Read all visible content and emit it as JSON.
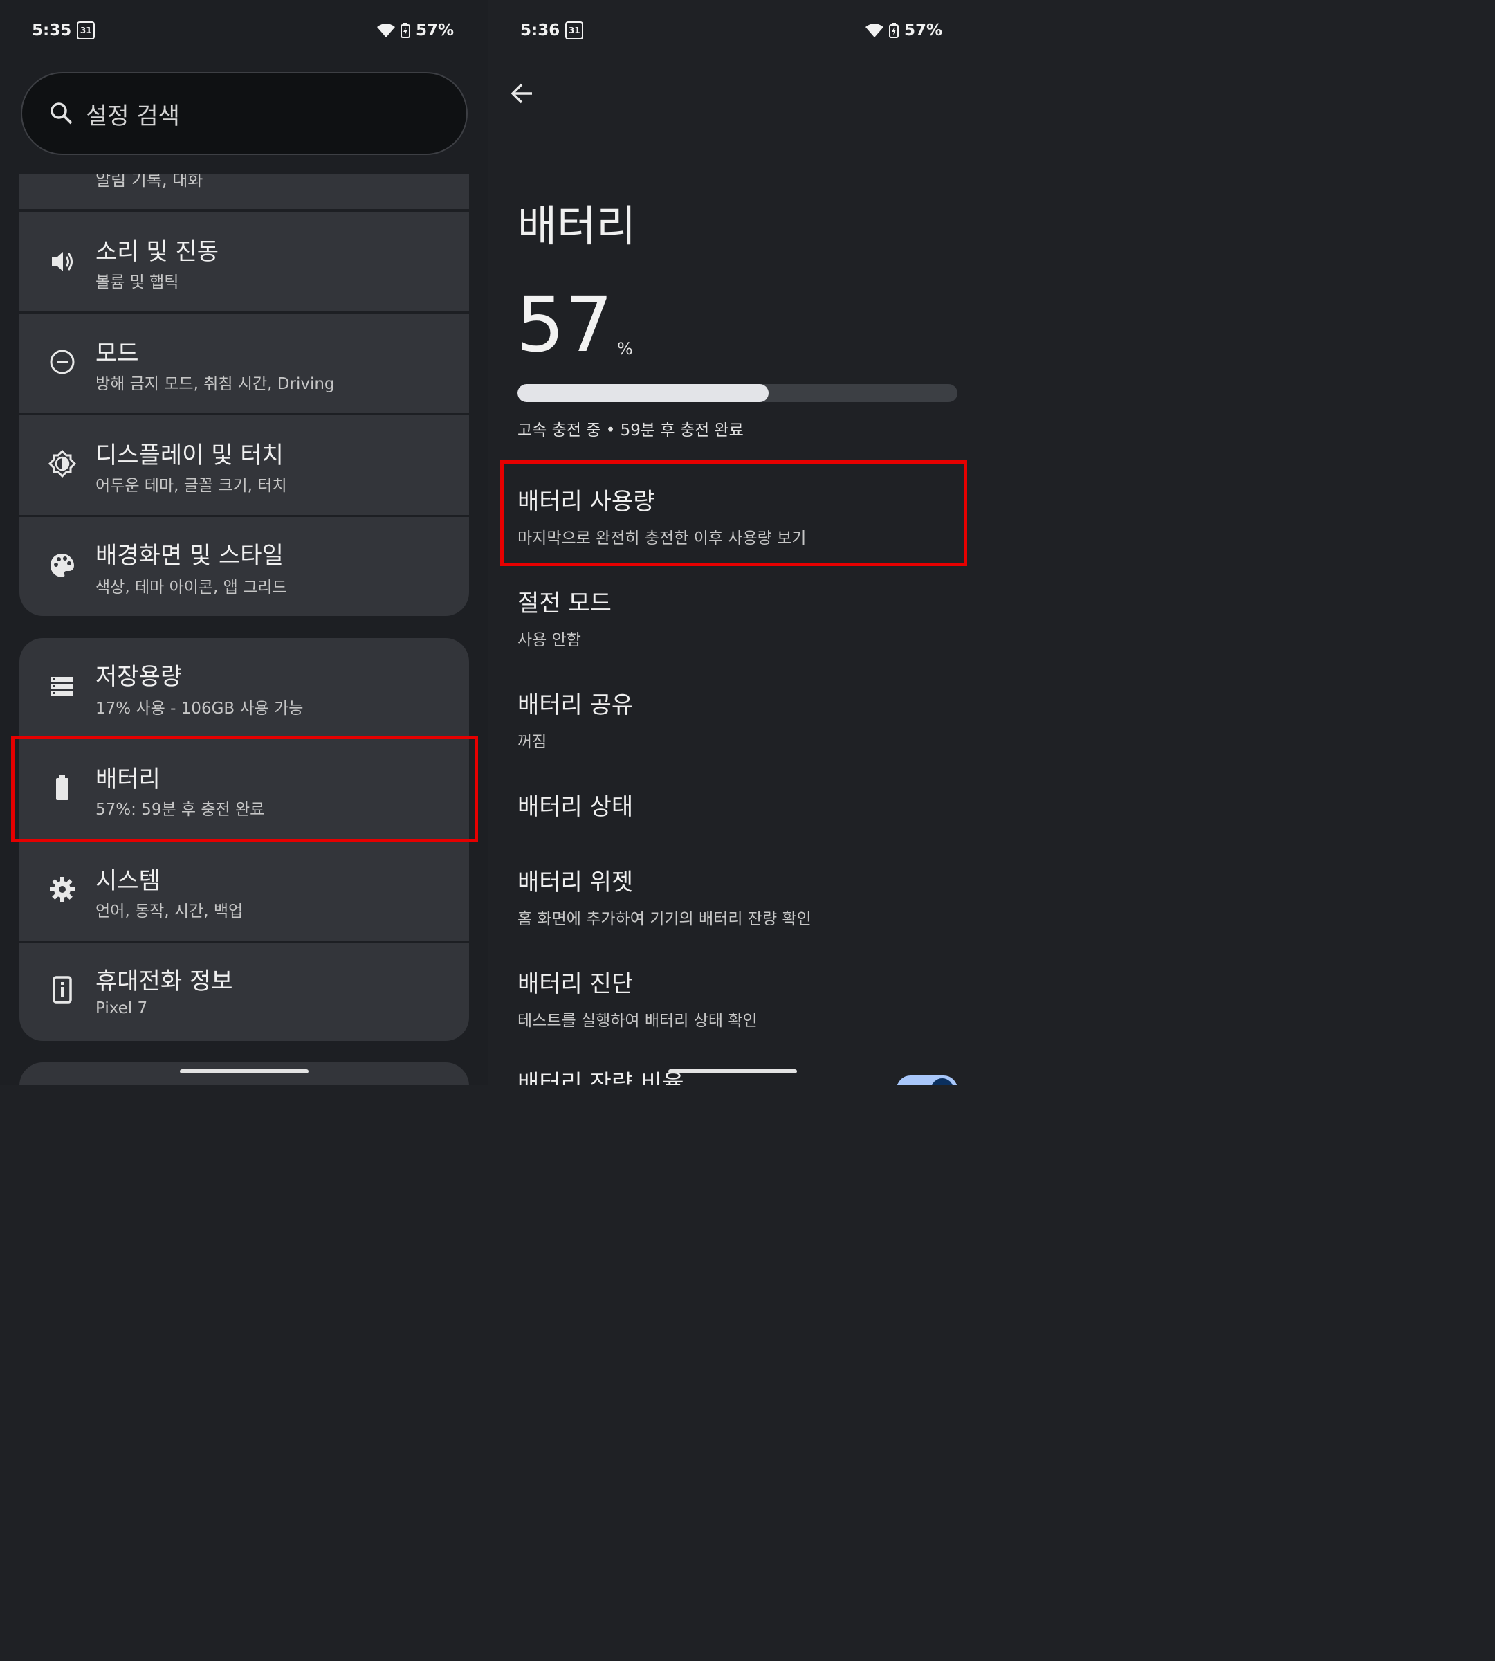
{
  "left": {
    "status": {
      "time": "5:35",
      "calendar_day": "31",
      "battery": "57%"
    },
    "search": {
      "placeholder": "설정 검색"
    },
    "partial_top_sub": "알림 기록, 대화",
    "items": [
      {
        "title": "소리 및 진동",
        "sub": "볼륨 및 햅틱",
        "icon": "volume-icon"
      },
      {
        "title": "모드",
        "sub": "방해 금지 모드, 취침 시간, Driving",
        "icon": "mode-icon"
      },
      {
        "title": "디스플레이 및 터치",
        "sub": "어두운 테마, 글꼴 크기, 터치",
        "icon": "display-brightness-icon"
      },
      {
        "title": "배경화면 및 스타일",
        "sub": "색상, 테마 아이콘, 앱 그리드",
        "icon": "palette-icon"
      },
      {
        "title": "저장용량",
        "sub": "17% 사용 - 106GB 사용 가능",
        "icon": "storage-icon"
      },
      {
        "title": "배터리",
        "sub": "57%: 59분 후 충전 완료",
        "icon": "battery-icon"
      },
      {
        "title": "시스템",
        "sub": "언어, 동작, 시간, 백업",
        "icon": "gear-icon"
      },
      {
        "title": "휴대전화 정보",
        "sub": "Pixel 7",
        "icon": "phone-info-icon"
      }
    ]
  },
  "right": {
    "status": {
      "time": "5:36",
      "calendar_day": "31",
      "battery": "57%"
    },
    "page_title": "배터리",
    "level_value": "57",
    "level_unit": "%",
    "level_fraction": 0.57,
    "charge_status": "고속 충전 중 • 59분 후 충전 완료",
    "items": [
      {
        "title": "배터리 사용량",
        "sub": "마지막으로 완전히 충전한 이후 사용량 보기"
      },
      {
        "title": "절전 모드",
        "sub": "사용 안함"
      },
      {
        "title": "배터리 공유",
        "sub": "꺼짐"
      },
      {
        "title": "배터리 상태",
        "sub": ""
      },
      {
        "title": "배터리 위젯",
        "sub": "홈 화면에 추가하여 기기의 배터리 잔량 확인"
      },
      {
        "title": "배터리 진단",
        "sub": "테스트를 실행하여 배터리 상태 확인"
      },
      {
        "title": "배터리 잔량 비율",
        "sub": ""
      }
    ]
  },
  "colors": {
    "highlight": "#e60000",
    "accent_toggle": "#a8c7fa"
  }
}
